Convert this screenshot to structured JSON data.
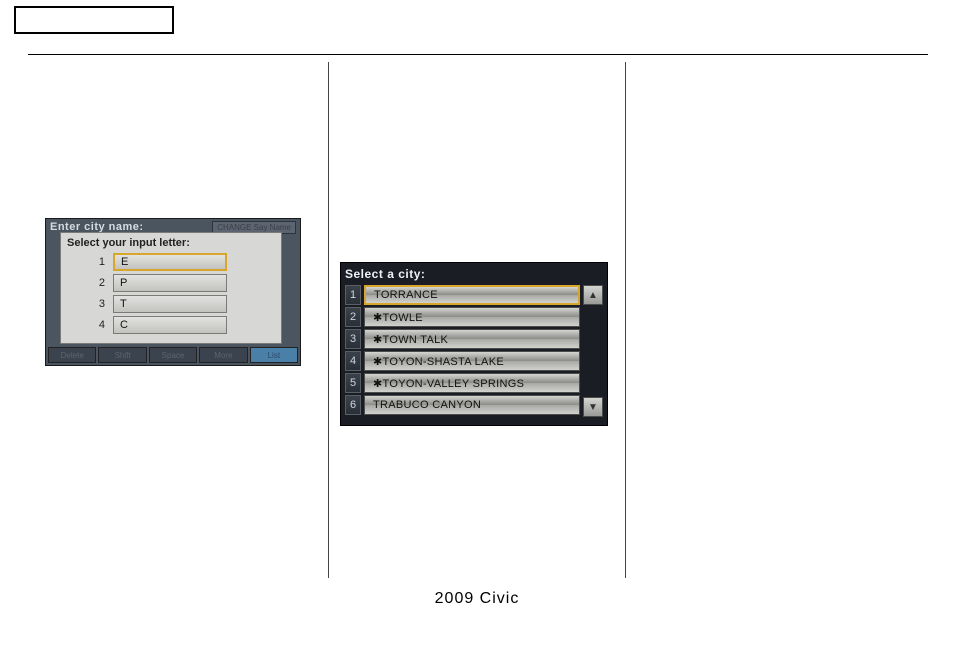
{
  "footer": "2009  Civic",
  "panel1": {
    "bg_title": "Enter city name:",
    "sayname": "CHANGE Say Name",
    "popup_title": "Select your input letter:",
    "rows": [
      {
        "n": "1",
        "v": "E"
      },
      {
        "n": "2",
        "v": "P"
      },
      {
        "n": "3",
        "v": "T"
      },
      {
        "n": "4",
        "v": "C"
      }
    ],
    "bottom": {
      "delete": "Delete",
      "shift": "Shift",
      "space": "Space",
      "more": "More",
      "list": "List"
    }
  },
  "panel2": {
    "title": "Select a city:",
    "rows": [
      {
        "n": "1",
        "v": " TORRANCE"
      },
      {
        "n": "2",
        "v": "✱TOWLE"
      },
      {
        "n": "3",
        "v": "✱TOWN TALK"
      },
      {
        "n": "4",
        "v": "✱TOYON-SHASTA LAKE"
      },
      {
        "n": "5",
        "v": "✱TOYON-VALLEY SPRINGS"
      },
      {
        "n": "6",
        "v": " TRABUCO CANYON"
      }
    ],
    "up": "▲",
    "down": "▼"
  }
}
